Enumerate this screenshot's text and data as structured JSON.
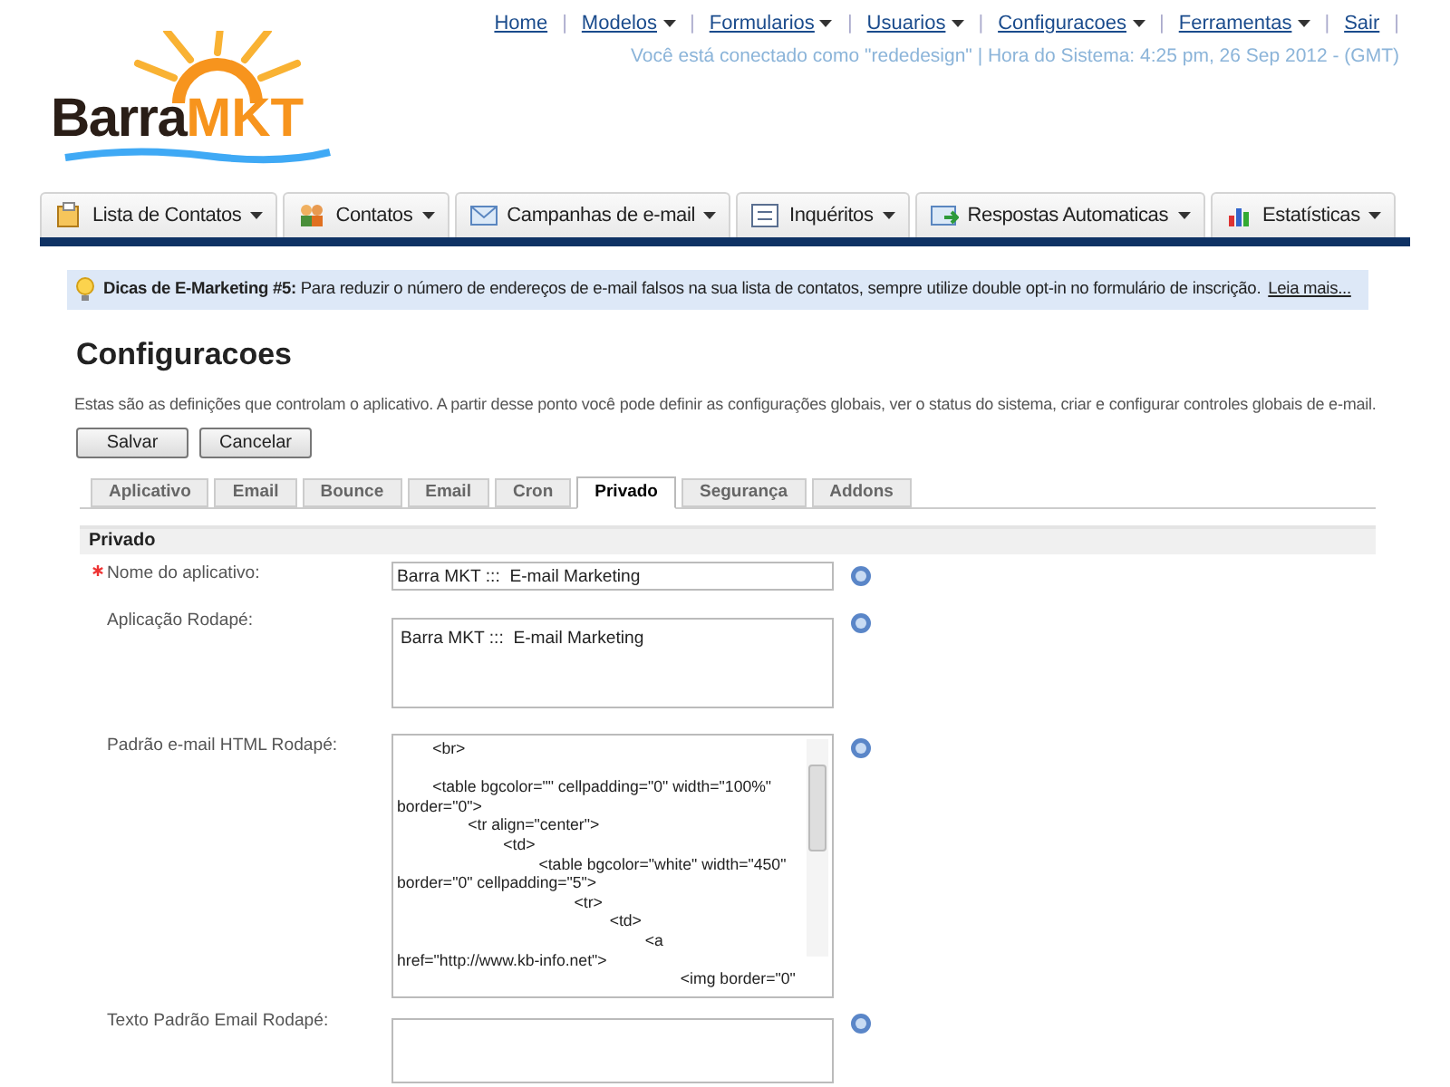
{
  "top_nav": [
    {
      "label": "Home",
      "dropdown": false,
      "separator": "|"
    },
    {
      "label": "Modelos",
      "dropdown": true,
      "separator": "|"
    },
    {
      "label": "Formularios",
      "dropdown": true,
      "separator": "|"
    },
    {
      "label": "Usuarios",
      "dropdown": true,
      "separator": "|"
    },
    {
      "label": "Configuracoes",
      "dropdown": true,
      "separator": "|"
    },
    {
      "label": "Ferramentas",
      "dropdown": true,
      "separator": "|"
    },
    {
      "label": "Sair",
      "dropdown": false,
      "separator": "|"
    }
  ],
  "status": "Você está conectado como \"rededesign\" | Hora do Sistema: 4:25 pm, 26 Sep 2012 - (GMT)",
  "logo": {
    "word_1": "Barra",
    "word_2": "MKT"
  },
  "main_menu": [
    {
      "label": "Lista de Contatos",
      "kind": "list"
    },
    {
      "label": "Contatos",
      "kind": "people"
    },
    {
      "label": "Campanhas de e-mail",
      "kind": "mail"
    },
    {
      "label": "Inquéritos",
      "kind": "form"
    },
    {
      "label": "Respostas Automaticas",
      "kind": "reply"
    },
    {
      "label": "Estatísticas",
      "kind": "chart"
    }
  ],
  "tip": {
    "text": "**Dicas de E-Marketing #5:** Para reduzir o número de endereços de e-mail falsos na sua lista de contatos, sempre utilize double opt-in no formulário de inscrição.",
    "link": "Leia mais..."
  },
  "page_title": "Configuracoes",
  "description": "Estas são as definições que controlam o aplicativo. A partir desse ponto você pode definir as configurações globais, ver o status do sistema, criar e configurar controles globais de e-mail.",
  "buttons": [
    "Salvar",
    "Cancelar"
  ],
  "tabs": [
    {
      "label": "Aplicativo",
      "selected": false
    },
    {
      "label": "Email",
      "selected": false
    },
    {
      "label": "Bounce",
      "selected": false
    },
    {
      "label": "Email",
      "selected": false
    },
    {
      "label": "Cron",
      "selected": false
    },
    {
      "label": "Privado",
      "selected": true
    },
    {
      "label": "Segurança",
      "selected": false
    },
    {
      "label": "Addons",
      "selected": false
    }
  ],
  "section": "Privado",
  "fields": [
    {
      "label": "Nome do aplicativo:",
      "required": true,
      "kind": "input",
      "value": "Barra MKT :::  E-mail Marketing"
    },
    {
      "label": "Aplicação Rodapé:",
      "required": false,
      "kind": "textarea",
      "value": "Barra MKT :::  E-mail Marketing"
    },
    {
      "label": "Padrão e-mail HTML Rodapé:",
      "required": false,
      "kind": "code",
      "value": "        <br>\n\n        <table bgcolor=\"\" cellpadding=\"0\" width=\"100%\"\nborder=\"0\">\n                <tr align=\"center\">\n                        <td>\n                                <table bgcolor=\"white\" width=\"450\"\nborder=\"0\" cellpadding=\"5\">\n                                        <tr>\n                                                <td>\n                                                        <a\nhref=\"http://www.kb-info.net\">\n                                                                <img border=\"0\""
    },
    {
      "label": "Texto Padrão Email Rodapé:",
      "required": false,
      "kind": "textarea"
    }
  ]
}
